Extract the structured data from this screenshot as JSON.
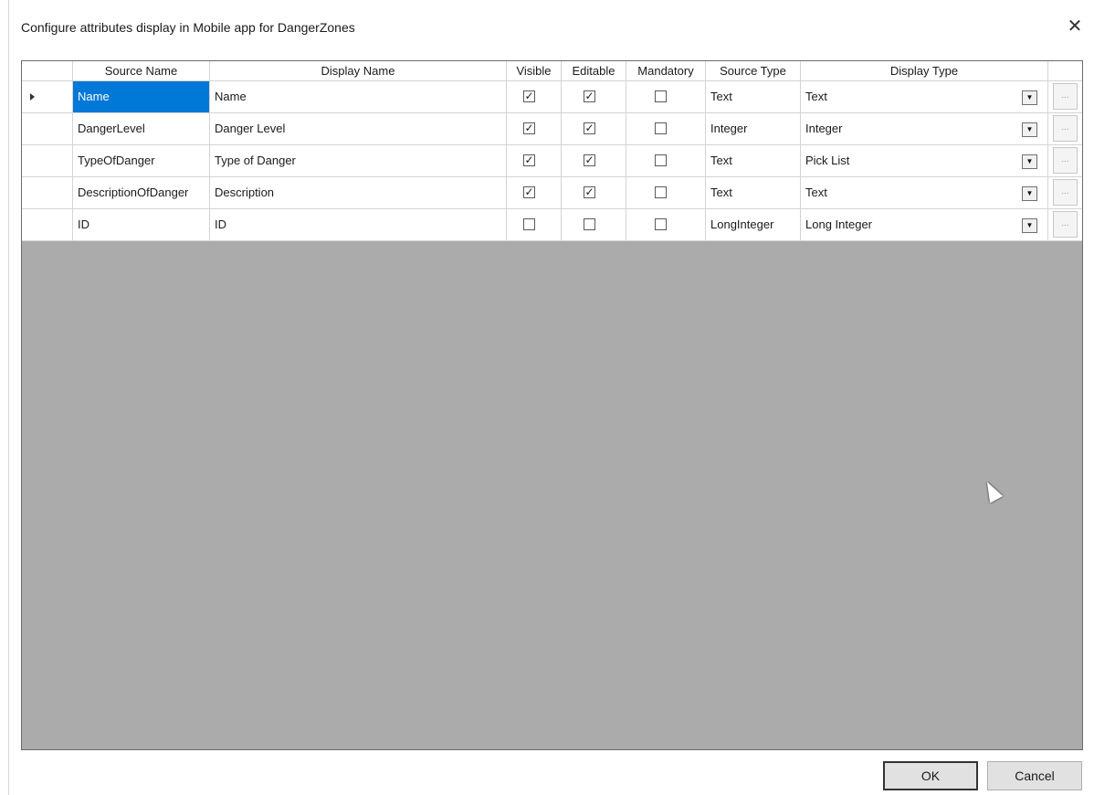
{
  "window": {
    "title": "Configure attributes display in Mobile app for DangerZones",
    "close_glyph": "✕"
  },
  "grid": {
    "columns": [
      "",
      "Source Name",
      "Display Name",
      "Visible",
      "Editable",
      "Mandatory",
      "Source Type",
      "Display Type",
      ""
    ],
    "rows": [
      {
        "source_name": "Name",
        "display_name": "Name",
        "visible": true,
        "editable": true,
        "mandatory": false,
        "source_type": "Text",
        "display_type": "Text",
        "selected": true
      },
      {
        "source_name": "DangerLevel",
        "display_name": "Danger Level",
        "visible": true,
        "editable": true,
        "mandatory": false,
        "source_type": "Integer",
        "display_type": "Integer",
        "selected": false
      },
      {
        "source_name": "TypeOfDanger",
        "display_name": "Type of Danger",
        "visible": true,
        "editable": true,
        "mandatory": false,
        "source_type": "Text",
        "display_type": "Pick List",
        "selected": false
      },
      {
        "source_name": "DescriptionOfDanger",
        "display_name": "Description",
        "visible": true,
        "editable": true,
        "mandatory": false,
        "source_type": "Text",
        "display_type": "Text",
        "selected": false
      },
      {
        "source_name": "ID",
        "display_name": "ID",
        "visible": false,
        "editable": false,
        "mandatory": false,
        "source_type": "LongInteger",
        "display_type": "Long Integer",
        "selected": false
      }
    ],
    "check_glyph": "✓",
    "combo_glyph": "▼",
    "ellipsis_glyph": "..."
  },
  "buttons": {
    "ok": "OK",
    "cancel": "Cancel"
  },
  "colors": {
    "selection": "#0078d7",
    "grid_background": "#ababab",
    "pointer_marker": "#6db33f"
  }
}
